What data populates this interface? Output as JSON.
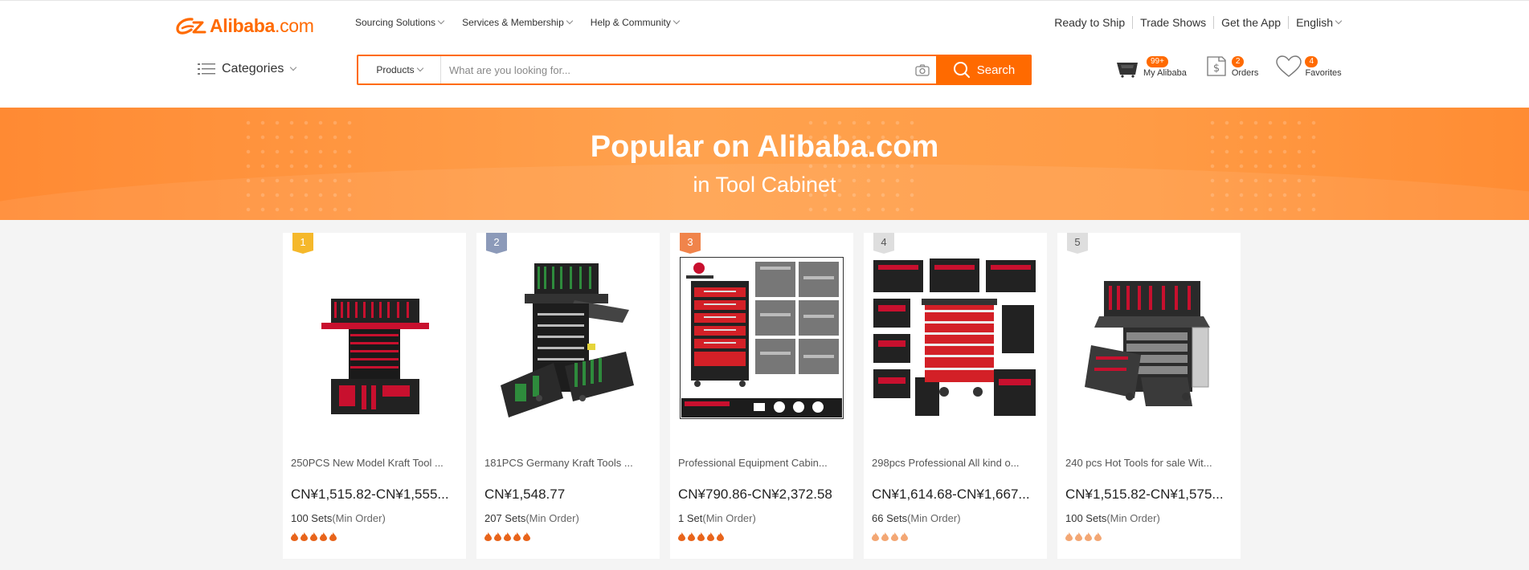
{
  "brand": {
    "logo_text": "Alibaba",
    "logo_suffix": ".com",
    "color": "#ff6a00"
  },
  "topnav": [
    {
      "label": "Sourcing Solutions"
    },
    {
      "label": "Services & Membership"
    },
    {
      "label": "Help & Community"
    }
  ],
  "toplinks": {
    "ready_to_ship": "Ready to Ship",
    "trade_shows": "Trade Shows",
    "get_app": "Get the App",
    "language": "English"
  },
  "categories": {
    "label": "Categories"
  },
  "search": {
    "type": "Products",
    "placeholder": "What are you looking for...",
    "button": "Search"
  },
  "user": {
    "my_alibaba": {
      "label": "My Alibaba",
      "badge": "99+"
    },
    "orders": {
      "label": "Orders",
      "badge": "2"
    },
    "favorites": {
      "label": "Favorites",
      "badge": "4"
    }
  },
  "banner": {
    "title": "Popular on Alibaba.com",
    "subtitle": "in Tool Cabinet"
  },
  "products": [
    {
      "rank": "1",
      "title": "250PCS New Model Kraft Tool ...",
      "price": "CN¥1,515.82-CN¥1,555...",
      "moq_value": "100 Sets",
      "moq_label": "(Min Order)",
      "rating": 5,
      "flame_color": "#e8641b"
    },
    {
      "rank": "2",
      "title": "181PCS Germany Kraft Tools ...",
      "price": "CN¥1,548.77",
      "moq_value": "207 Sets",
      "moq_label": "(Min Order)",
      "rating": 5,
      "flame_color": "#e8641b"
    },
    {
      "rank": "3",
      "title": "Professional Equipment Cabin...",
      "price": "CN¥790.86-CN¥2,372.58",
      "moq_value": "1 Set",
      "moq_label": "(Min Order)",
      "rating": 5,
      "flame_color": "#e8641b"
    },
    {
      "rank": "4",
      "title": "298pcs Professional All kind o...",
      "price": "CN¥1,614.68-CN¥1,667...",
      "moq_value": "66 Sets",
      "moq_label": "(Min Order)",
      "rating": 4,
      "flame_color": "#f3a774"
    },
    {
      "rank": "5",
      "title": "240 pcs Hot Tools for sale Wit...",
      "price": "CN¥1,515.82-CN¥1,575...",
      "moq_value": "100 Sets",
      "moq_label": "(Min Order)",
      "rating": 4,
      "flame_color": "#f3a774"
    }
  ]
}
